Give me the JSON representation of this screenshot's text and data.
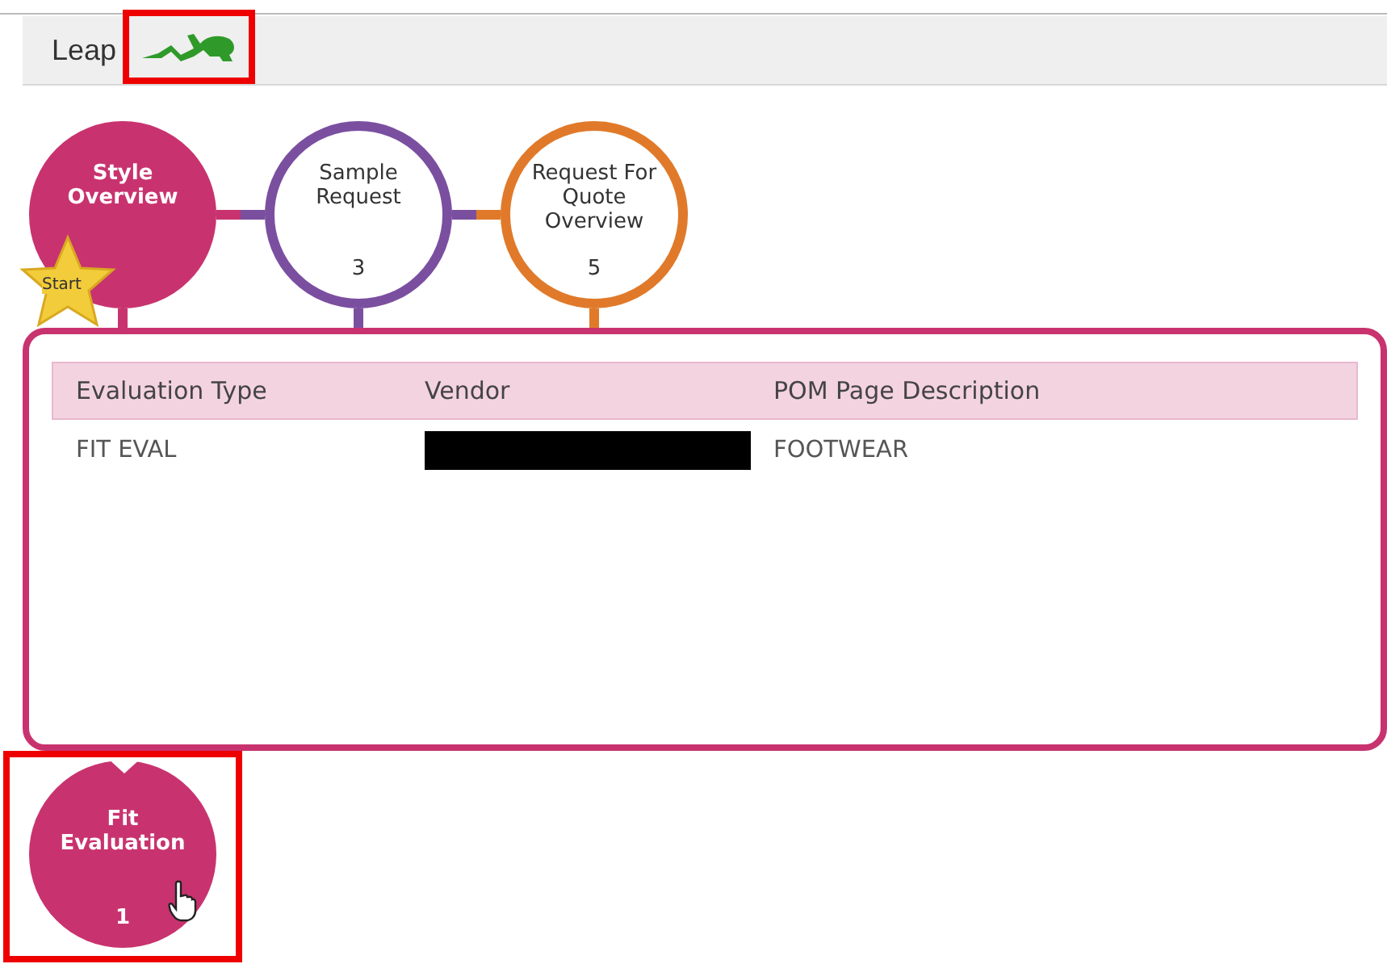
{
  "header": {
    "title": "Leap"
  },
  "stages": [
    {
      "label": "Style Overview",
      "color": "#c8336f",
      "filled": true,
      "badge": "Start"
    },
    {
      "label": "Sample Request",
      "count": "3",
      "color": "#7b4fa0",
      "filled": false
    },
    {
      "label": "Request For Quote Overview",
      "count": "5",
      "color": "#e07a2a",
      "filled": false
    }
  ],
  "table": {
    "columns": [
      "Evaluation Type",
      "Vendor",
      "POM Page Description"
    ],
    "rows": [
      {
        "cells": [
          {
            "text": "FIT EVAL"
          },
          {
            "kind": "redacted"
          },
          {
            "text": "FOOTWEAR"
          }
        ]
      }
    ]
  },
  "sub_stage": {
    "label": "Fit Evaluation",
    "count": "1",
    "color": "#c8336f",
    "filled": true
  }
}
